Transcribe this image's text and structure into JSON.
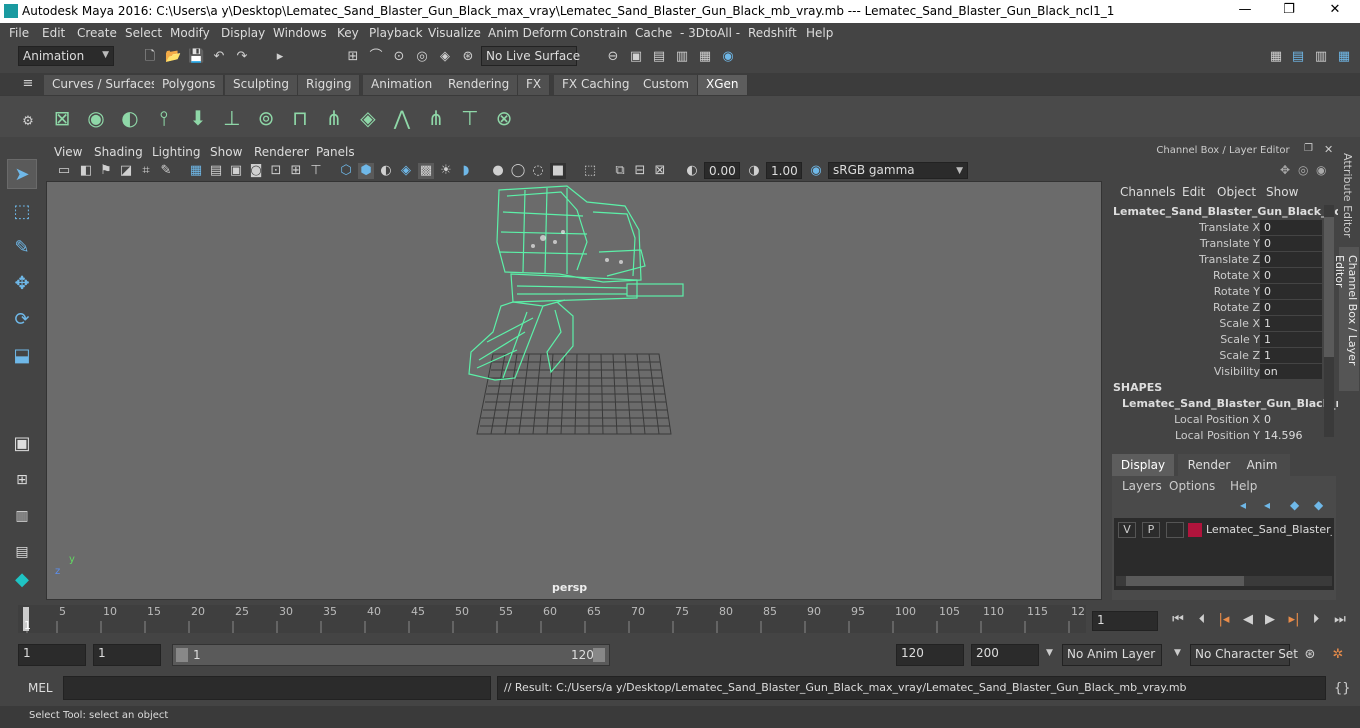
{
  "window": {
    "title": "Autodesk Maya 2016: C:\\Users\\a y\\Desktop\\Lematec_Sand_Blaster_Gun_Black_max_vray\\Lematec_Sand_Blaster_Gun_Black_mb_vray.mb   ---   Lematec_Sand_Blaster_Gun_Black_ncl1_1",
    "minimize": "—",
    "maximize": "❐",
    "close": "✕"
  },
  "menubar": [
    "File",
    "Edit",
    "Create",
    "Select",
    "Modify",
    "Display",
    "Windows",
    "Key",
    "Playback",
    "Visualize",
    "Anim Deform",
    "Constrain",
    "Cache",
    "- 3DtoAll -",
    "Redshift",
    "Help"
  ],
  "statusline": {
    "mode": "Animation",
    "live_surface": "No Live Surface"
  },
  "shelf_tabs": [
    "Curves / Surfaces",
    "Polygons",
    "Sculpting",
    "Rigging",
    "Animation",
    "Rendering",
    "FX",
    "FX Caching",
    "Custom",
    "XGen"
  ],
  "shelf_active": "XGen",
  "viewport": {
    "menu": [
      "View",
      "Shading",
      "Lighting",
      "Show",
      "Renderer",
      "Panels"
    ],
    "exposure": "0.00",
    "gamma": "1.00",
    "color_space": "sRGB gamma",
    "camera_label": "persp",
    "axis_y": "y",
    "axis_z": "z"
  },
  "channel_box": {
    "header": "Channel Box / Layer Editor",
    "menu": [
      "Channels",
      "Edit",
      "Object",
      "Show"
    ],
    "object_name": "Lematec_Sand_Blaster_Gun_Black_ncl...",
    "attributes": [
      {
        "label": "Translate X",
        "value": "0"
      },
      {
        "label": "Translate Y",
        "value": "0"
      },
      {
        "label": "Translate Z",
        "value": "0"
      },
      {
        "label": "Rotate X",
        "value": "0"
      },
      {
        "label": "Rotate Y",
        "value": "0"
      },
      {
        "label": "Rotate Z",
        "value": "0"
      },
      {
        "label": "Scale X",
        "value": "1"
      },
      {
        "label": "Scale Y",
        "value": "1"
      },
      {
        "label": "Scale Z",
        "value": "1"
      },
      {
        "label": "Visibility",
        "value": "on"
      }
    ],
    "shapes_heading": "SHAPES",
    "shape_name": "Lematec_Sand_Blaster_Gun_Black_n...",
    "shape_attributes": [
      {
        "label": "Local Position X",
        "value": "0"
      },
      {
        "label": "Local Position Y",
        "value": "14.596"
      }
    ]
  },
  "layer_editor": {
    "tabs": [
      "Display",
      "Render",
      "Anim"
    ],
    "active_tab": "Display",
    "menu": [
      "Layers",
      "Options",
      "Help"
    ],
    "layer": {
      "v": "V",
      "p": "P",
      "name": "Lematec_Sand_Blaster_G",
      "color": "#b0143c"
    }
  },
  "side_tabs": [
    "Attribute Editor",
    "Channel Box / Layer Editor"
  ],
  "timeline": {
    "ticks": [
      "5",
      "10",
      "15",
      "20",
      "25",
      "30",
      "35",
      "40",
      "45",
      "50",
      "55",
      "60",
      "65",
      "70",
      "75",
      "80",
      "85",
      "90",
      "95",
      "100",
      "105",
      "110",
      "115",
      "12"
    ],
    "current_frame_marker": "1",
    "current_frame_field": "1"
  },
  "range": {
    "start": "1",
    "playback_start": "1",
    "slider_start": "1",
    "slider_end": "120",
    "playback_end": "120",
    "end": "200",
    "anim_layer": "No Anim Layer",
    "character_set": "No Character Set"
  },
  "command": {
    "lang": "MEL",
    "result": "// Result: C:/Users/a y/Desktop/Lematec_Sand_Blaster_Gun_Black_max_vray/Lematec_Sand_Blaster_Gun_Black_mb_vray.mb"
  },
  "helpline": "Select Tool: select an object",
  "colors": {
    "wireframe": "#5cf0a8",
    "accent": "#6fb8e8",
    "layer_color": "#b0143c"
  }
}
